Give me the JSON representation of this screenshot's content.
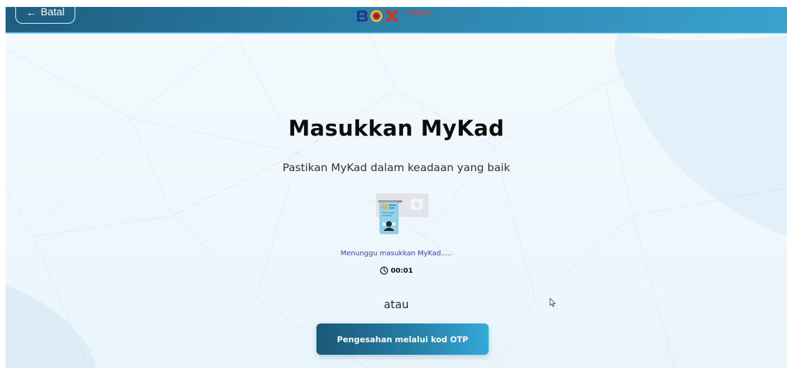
{
  "header": {
    "back_label": "Batal",
    "logo_text": "BOX",
    "logo_sub": "PPTCWP"
  },
  "main": {
    "title": "Masukkan MyKad",
    "subtitle": "Pastikan MyKad dalam keadaan yang baik",
    "status": "Menunggu masukkan MyKad.....",
    "timer": "00:01",
    "separator": "atau",
    "otp_button": "Pengesahan melalui kod OTP"
  },
  "colors": {
    "header_start": "#1e5d80",
    "header_end": "#3aa2cf",
    "status_text": "#3b3fb8",
    "button_start": "#1a5878",
    "button_end": "#34a9d8"
  },
  "icons": [
    "back-arrow-icon",
    "clock-icon",
    "mykad-insert-icon",
    "mouse-cursor-icon"
  ]
}
